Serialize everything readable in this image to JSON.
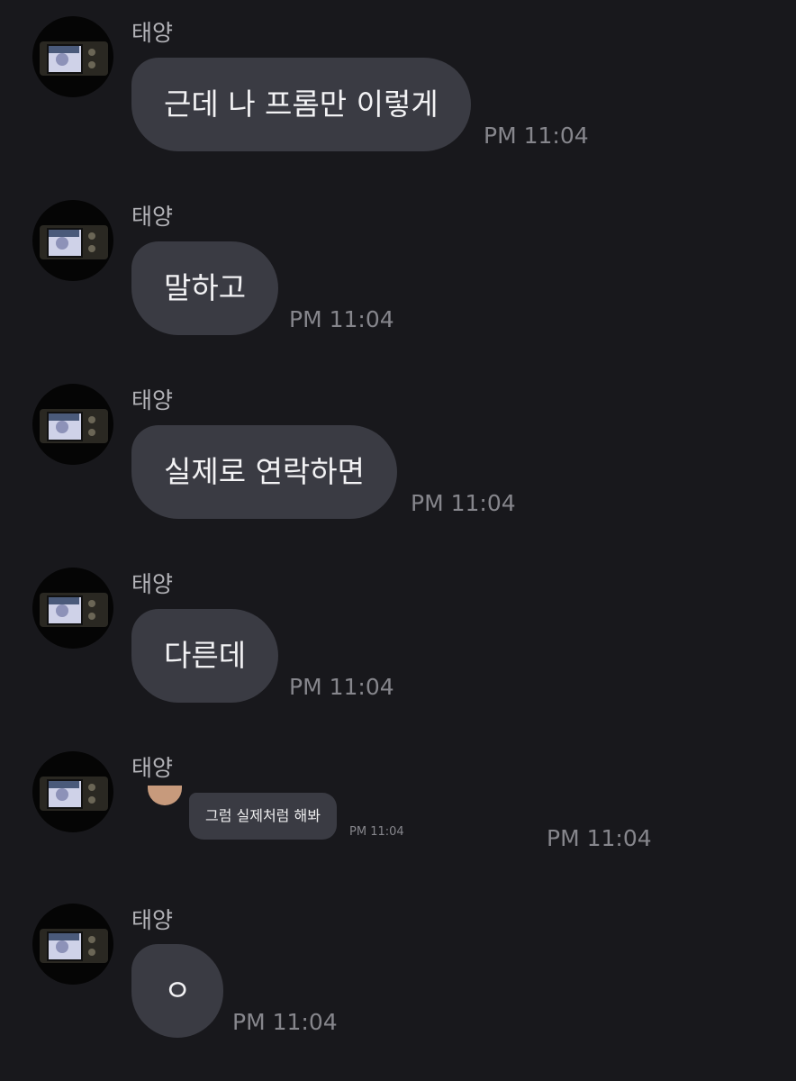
{
  "messages": [
    {
      "sender": "태양",
      "text": "근데 나 프롬만 이렇게",
      "time": "PM 11:04"
    },
    {
      "sender": "태양",
      "text": "말하고",
      "time": "PM 11:04"
    },
    {
      "sender": "태양",
      "text": "실제로 연락하면",
      "time": "PM 11:04"
    },
    {
      "sender": "태양",
      "text": "다른데",
      "time": "PM 11:04"
    },
    {
      "sender": "태양",
      "time": "PM 11:04",
      "image": {
        "text": "그럼 실제처럼 해봐",
        "time": "PM 11:04"
      }
    },
    {
      "sender": "태양",
      "text": "ㅇ",
      "time": "PM 11:04"
    }
  ],
  "colors": {
    "background": "#18181c",
    "bubble": "#3a3b43",
    "text": "#f2f2f4",
    "name": "#b3b3b8",
    "time": "#86868c"
  }
}
